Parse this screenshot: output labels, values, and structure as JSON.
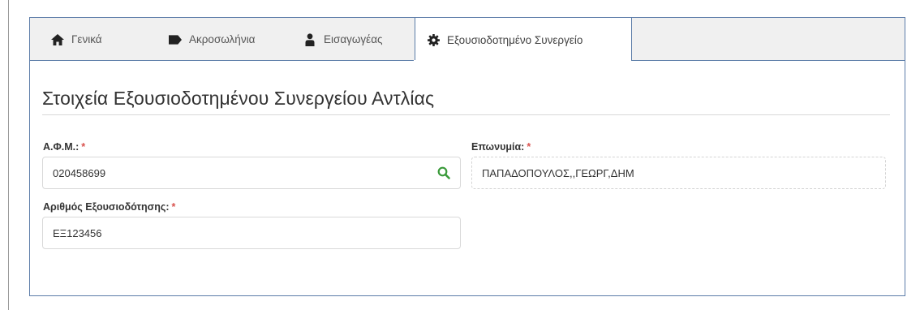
{
  "tabs": [
    {
      "label": "Γενικά",
      "icon": "home-icon",
      "active": false
    },
    {
      "label": "Ακροσωλήνια",
      "icon": "tag-icon",
      "active": false
    },
    {
      "label": "Εισαγωγέας",
      "icon": "user-icon",
      "active": false
    },
    {
      "label": "Εξουσιοδοτημένο Συνεργείο",
      "icon": "gear-icon",
      "active": true
    }
  ],
  "section": {
    "title": "Στοιχεία Εξουσιοδοτημένου Συνεργείου Αντλίας"
  },
  "form": {
    "afm": {
      "label": "Α.Φ.Μ.:",
      "required_mark": "*",
      "value": "020458699"
    },
    "eponymia": {
      "label": "Επωνυμία:",
      "required_mark": "*",
      "value": "ΠΑΠΑΔΟΠΟΥΛΟΣ,,ΓΕΩΡΓ,ΔΗΜ"
    },
    "authorization": {
      "label": "Αριθμός Εξουσιοδότησης:",
      "required_mark": "*",
      "value": "ΕΞ123456"
    }
  },
  "colors": {
    "accent_border": "#5b7ca8",
    "required": "#d9534f",
    "search_icon": "#3a9a3a"
  }
}
